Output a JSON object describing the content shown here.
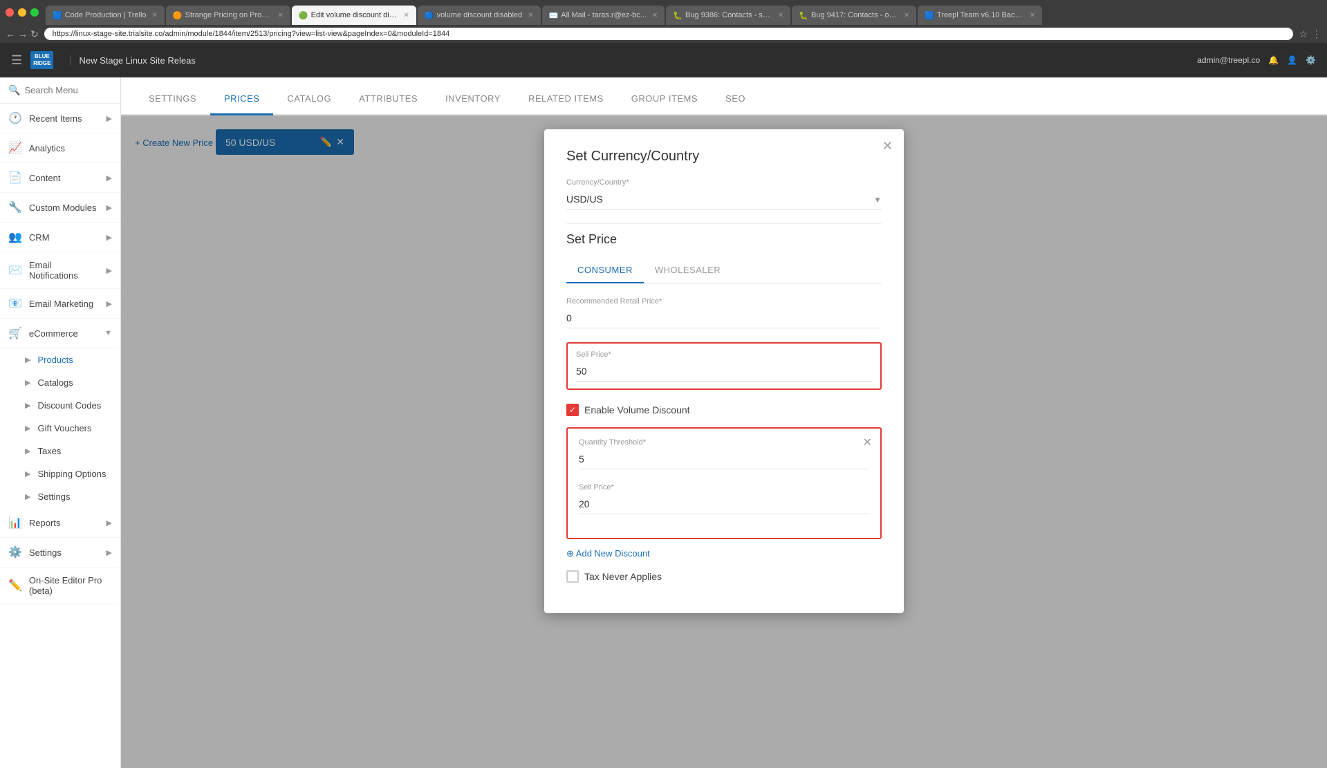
{
  "browser": {
    "tabs": [
      {
        "label": "Code Production | Trello",
        "active": false,
        "favicon": "🟦"
      },
      {
        "label": "Strange Pricing on Produ...",
        "active": false,
        "favicon": "🟠"
      },
      {
        "label": "Edit volume discount dis...",
        "active": true,
        "favicon": "🟢"
      },
      {
        "label": "volume discount disabled",
        "active": false,
        "favicon": "🔵"
      },
      {
        "label": "All Mail - taras.r@ez-bc...",
        "active": false,
        "favicon": "✉️"
      },
      {
        "label": "Bug 9386: Contacts - sea...",
        "active": false,
        "favicon": "🐛"
      },
      {
        "label": "Bug 9417: Contacts - ord...",
        "active": false,
        "favicon": "🐛"
      },
      {
        "label": "Treepl Team v6.10 Backlo...",
        "active": false,
        "favicon": "🟦"
      }
    ],
    "url": "https://linux-stage-site.trialsite.co/admin/module/1844/item/2513/pricing?view=list-view&pageIndex=0&moduleId=1844"
  },
  "topbar": {
    "logo_line1": "BLUE",
    "logo_line2": "RIDGE",
    "site_label": "New Stage Linux Site Releas",
    "user": "admin@treepl.co",
    "icons": [
      "🔔",
      "👤",
      "⚙️"
    ]
  },
  "sidebar": {
    "search_placeholder": "Search Menu",
    "items": [
      {
        "label": "Recent Items",
        "icon": "🕐",
        "has_arrow": true
      },
      {
        "label": "Analytics",
        "icon": "📈",
        "has_arrow": false
      },
      {
        "label": "Content",
        "icon": "📄",
        "has_arrow": true
      },
      {
        "label": "Custom Modules",
        "icon": "🔧",
        "has_arrow": true
      },
      {
        "label": "CRM",
        "icon": "👥",
        "has_arrow": true
      },
      {
        "label": "Email Notifications",
        "icon": "✉️",
        "has_arrow": true
      },
      {
        "label": "Email Marketing",
        "icon": "📧",
        "has_arrow": true
      },
      {
        "label": "eCommerce",
        "icon": "🛒",
        "has_arrow": true,
        "expanded": true
      }
    ],
    "ecommerce_sub": [
      {
        "label": "Products",
        "active": true
      },
      {
        "label": "Catalogs"
      },
      {
        "label": "Discount Codes"
      },
      {
        "label": "Gift Vouchers"
      },
      {
        "label": "Taxes"
      },
      {
        "label": "Shipping Options"
      },
      {
        "label": "Settings"
      }
    ],
    "bottom_items": [
      {
        "label": "Reports",
        "icon": "📊",
        "has_arrow": true
      },
      {
        "label": "Settings",
        "icon": "⚙️",
        "has_arrow": true
      },
      {
        "label": "On-Site Editor Pro (beta)",
        "icon": "✏️",
        "has_arrow": false
      }
    ]
  },
  "tabs": {
    "items": [
      "SETTINGS",
      "PRICES",
      "CATALOG",
      "ATTRIBUTES",
      "INVENTORY",
      "RELATED ITEMS",
      "GROUP ITEMS",
      "SEO"
    ],
    "active": "PRICES"
  },
  "page": {
    "create_link": "+ Create New Price",
    "price_item_label": "50 USD/US"
  },
  "modal": {
    "title": "Set Currency/Country",
    "currency_country_label": "Currency/Country*",
    "currency_country_value": "USD/US",
    "set_price_title": "Set Price",
    "price_tabs": [
      {
        "label": "CONSUMER",
        "active": true
      },
      {
        "label": "WHOLESALER",
        "active": false
      }
    ],
    "rrp_label": "Recommended Retail Price*",
    "rrp_value": "0",
    "sell_price_label": "Sell Price*",
    "sell_price_value": "50",
    "enable_volume_discount_label": "Enable Volume Discount",
    "discount_block": {
      "qty_threshold_label": "Quantity Threshold*",
      "qty_threshold_value": "5",
      "sell_price_label": "Sell Price*",
      "sell_price_value": "20"
    },
    "add_new_discount_label": "⊕ Add New Discount",
    "tax_never_label": "Tax Never Applies"
  }
}
